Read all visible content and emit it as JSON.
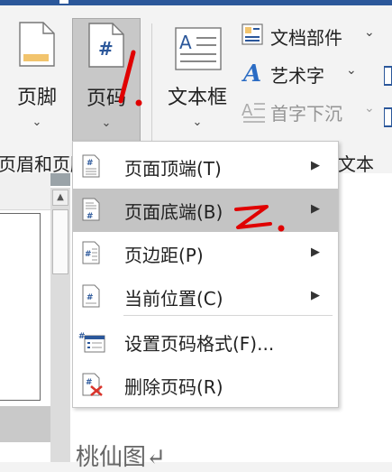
{
  "ribbon": {
    "footer_label": "页脚",
    "pagenum_label": "页码",
    "textbox_label": "文本框",
    "chev": "⌄",
    "doc_parts_label": "文档部件",
    "wordart_label": "艺术字",
    "dropcap_label": "首字下沉",
    "small_arrow": "⌄",
    "group_header_footer": "页眉和页脚",
    "group_text": "文本"
  },
  "menu": {
    "items": [
      {
        "label": "页面顶端(T)",
        "icon": "page-top-icon"
      },
      {
        "label": "页面底端(B)",
        "icon": "page-bottom-icon"
      },
      {
        "label": "页边距(P)",
        "icon": "page-margin-icon"
      },
      {
        "label": "当前位置(C)",
        "icon": "current-position-icon"
      },
      {
        "label": "设置页码格式(F)...",
        "icon": "format-page-number-icon"
      },
      {
        "label": "删除页码(R)",
        "icon": "remove-page-number-icon"
      }
    ],
    "submenu_arrow": "▶"
  },
  "document": {
    "body_text": "桃仙图↵"
  },
  "annotations": {
    "mark1": "1.",
    "mark2": "2."
  },
  "scroll": {
    "up_arrow": "▲"
  },
  "colors": {
    "highlight": "#c4c4c4",
    "annotation": "#e00000",
    "accent": "#2b579a"
  }
}
